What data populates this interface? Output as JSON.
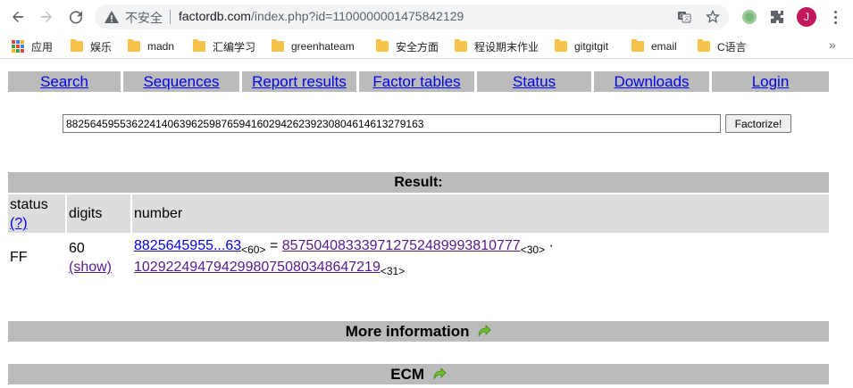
{
  "browser": {
    "security_label": "不安全",
    "url_host": "factordb.com",
    "url_path": "/index.php?id=1100000001475842129",
    "avatar_letter": "J"
  },
  "bookmarks": {
    "items": [
      {
        "label": "应用",
        "icon": "apps-grid-icon"
      },
      {
        "label": "娱乐",
        "icon": "folder-icon"
      },
      {
        "label": "madn",
        "icon": "folder-icon"
      },
      {
        "label": "汇编学习",
        "icon": "folder-icon"
      },
      {
        "label": "greenhateam",
        "icon": "folder-icon"
      },
      {
        "label": "安全方面",
        "icon": "folder-icon"
      },
      {
        "label": "程设期末作业",
        "icon": "folder-icon"
      },
      {
        "label": "gitgitgit",
        "icon": "folder-icon"
      },
      {
        "label": "email",
        "icon": "folder-icon"
      },
      {
        "label": "C语言",
        "icon": "folder-icon"
      }
    ],
    "more": "»"
  },
  "menu": {
    "items": [
      "Search",
      "Sequences",
      "Report results",
      "Factor tables",
      "Status",
      "Downloads",
      "Login"
    ]
  },
  "search": {
    "value": "882564595536224140639625987659416029426239230804614613279163",
    "button_label": "Factorize!"
  },
  "result": {
    "heading": "Result:",
    "columns": {
      "status": "status",
      "help": "(?)",
      "digits": "digits",
      "number": "number"
    },
    "row": {
      "status": "FF",
      "digits": "60",
      "show": "(show)",
      "number_short": "8825645955...63",
      "number_digits": "<60>",
      "equals": " = ",
      "factor1": "857504083339712752489993810777",
      "factor1_digits": "<30>",
      "times": " · ",
      "factor2": "1029224947942998075080348647219",
      "factor2_digits": "<31>"
    }
  },
  "sections": {
    "more_info": "More information",
    "ecm": "ECM"
  },
  "colors": {
    "bar_gray": "#bbbbbb",
    "header_gray": "#dddddd",
    "link": "#0000ee",
    "visited": "#551a8b",
    "arrow_green": "#6abf2a"
  }
}
